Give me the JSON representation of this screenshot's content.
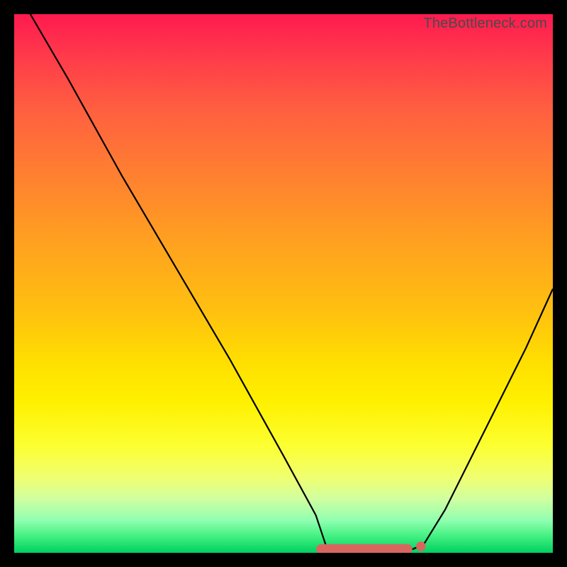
{
  "watermark": "TheBottleneck.com",
  "colors": {
    "gradient_top": "#ff1a4f",
    "gradient_bottom": "#00d060",
    "curve": "#000000",
    "marker": "#d8665f",
    "frame_bg": "#000000"
  },
  "chart_data": {
    "type": "line",
    "title": "",
    "xlabel": "",
    "ylabel": "",
    "xlim": [
      0,
      100
    ],
    "ylim": [
      0,
      100
    ],
    "grid": false,
    "legend": false,
    "description": "V-shaped bottleneck curve. Left branch descends steeply from ~100% at x≈3 to floor at ~x≈58; flat floor (~0%) from x≈58 to x≈75; right branch rises to ~49% at x=100.",
    "series": [
      {
        "name": "bottleneck",
        "x": [
          3,
          10,
          20,
          30,
          40,
          50,
          56,
          58,
          62,
          66,
          70,
          74,
          76,
          80,
          85,
          90,
          95,
          100
        ],
        "y": [
          100,
          88,
          70,
          53,
          36,
          18,
          7,
          1,
          0.5,
          0.5,
          0.5,
          0.7,
          1.5,
          8,
          18,
          28,
          38,
          49
        ]
      }
    ],
    "floor_markers": {
      "strip": {
        "x_start": 57,
        "x_end": 73,
        "y": 0.7
      },
      "dot": {
        "x": 75.5,
        "y": 1.2,
        "r": 0.9
      }
    }
  }
}
